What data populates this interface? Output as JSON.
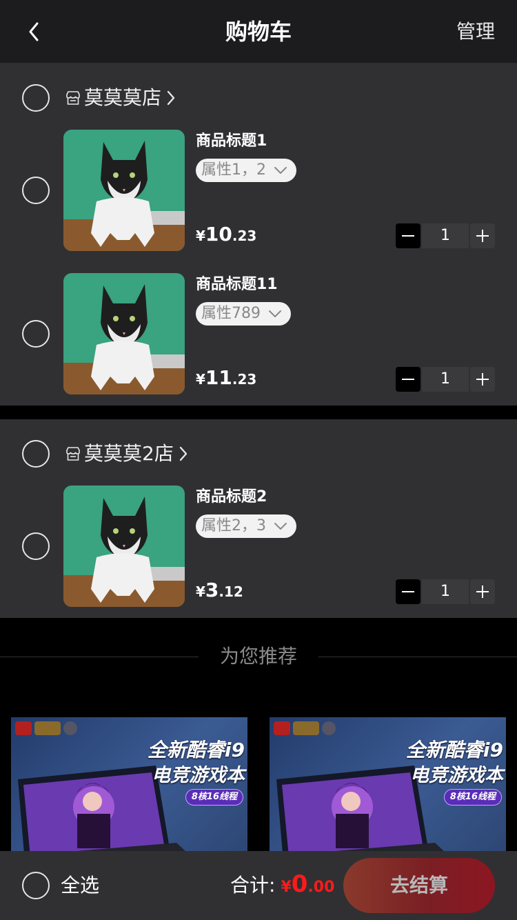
{
  "header": {
    "title": "购物车",
    "manage": "管理"
  },
  "shops": [
    {
      "name": "莫莫莫店",
      "items": [
        {
          "title": "商品标题1",
          "attr": "属性1，2",
          "price_int": "10",
          "price_dec": ".23",
          "qty": "1"
        },
        {
          "title": "商品标题11",
          "attr": "属性789",
          "price_int": "11",
          "price_dec": ".23",
          "qty": "1"
        }
      ]
    },
    {
      "name": "莫莫莫2店",
      "items": [
        {
          "title": "商品标题2",
          "attr": "属性2，3",
          "price_int": "3",
          "price_dec": ".12",
          "qty": "1"
        }
      ]
    }
  ],
  "currency": "¥",
  "recommend": {
    "heading": "为您推荐",
    "ads": [
      {
        "line1": "全新酷睿i9",
        "line2": "电竞游戏本",
        "badge": "8核16线程"
      },
      {
        "line1": "全新酷睿i9",
        "line2": "电竞游戏本",
        "badge": "8核16线程"
      }
    ]
  },
  "footer": {
    "select_all": "全选",
    "total_label": "合计:",
    "total_int": "0",
    "total_dec": ".00",
    "checkout": "去结算"
  },
  "colors": {
    "accent_red": "#ff1a1a",
    "panel": "#303033",
    "header": "#1c1c1e"
  },
  "icons": [
    "back-icon",
    "store-icon",
    "chevron-right-icon",
    "chevron-down-icon",
    "minus-icon",
    "plus-icon"
  ]
}
